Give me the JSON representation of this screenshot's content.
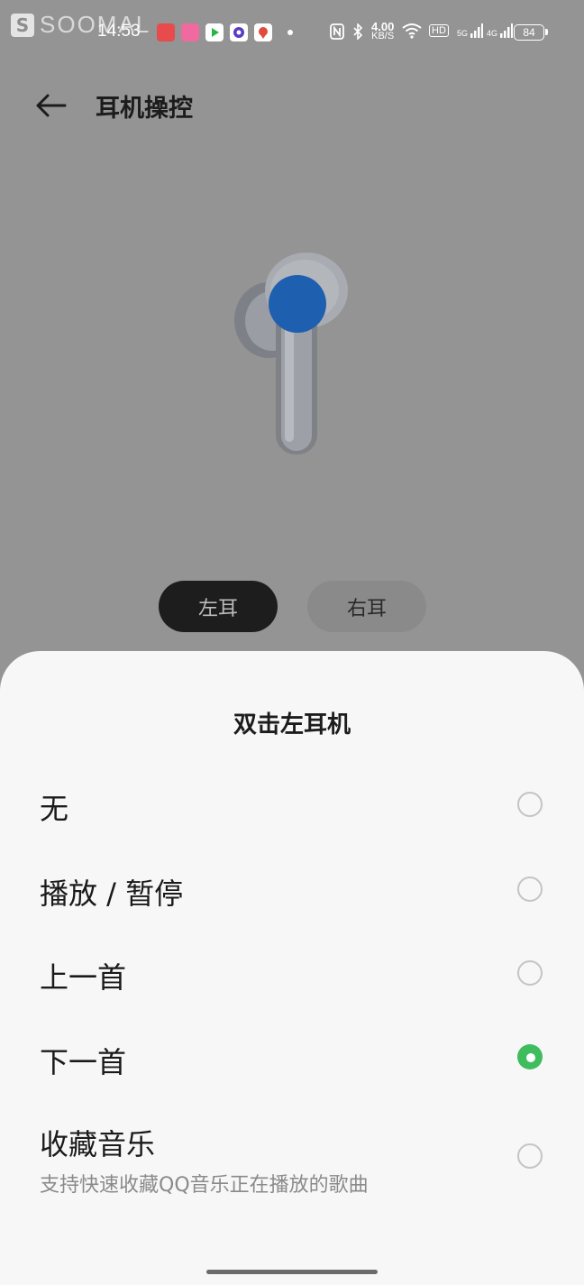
{
  "status_bar": {
    "watermark": "SOOMAL",
    "time": "14:53",
    "net_speed_value": "4.00",
    "net_speed_unit": "KB/S",
    "hd_label": "HD",
    "signal_1": "5G",
    "signal_2": "4G",
    "battery": "84"
  },
  "header": {
    "title": "耳机操控"
  },
  "ear_tabs": {
    "left": "左耳",
    "right": "右耳",
    "selected": "left"
  },
  "sheet": {
    "title": "双击左耳机",
    "options": [
      {
        "label": "无",
        "selected": false
      },
      {
        "label": "播放 / 暂停",
        "selected": false
      },
      {
        "label": "上一首",
        "selected": false
      },
      {
        "label": "下一首",
        "selected": true
      },
      {
        "label": "收藏音乐",
        "sub": "支持快速收藏QQ音乐正在播放的歌曲",
        "selected": false
      }
    ]
  },
  "colors": {
    "dim_background": "#949494",
    "sheet_background": "#f7f7f7",
    "radio_selected": "#3fbd5c",
    "earbud_highlight": "#1f5fb0"
  }
}
